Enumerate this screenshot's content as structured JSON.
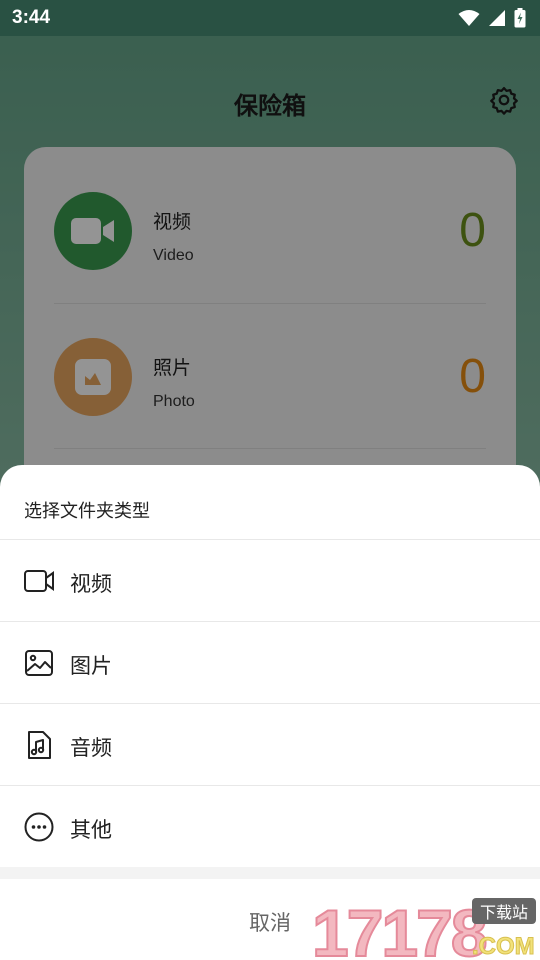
{
  "status_bar": {
    "time": "3:44",
    "icons": [
      "wifi-icon",
      "signal-icon",
      "battery-charging-icon"
    ]
  },
  "header": {
    "title": "保险箱",
    "settings_icon": "gear-icon"
  },
  "vault": {
    "rows": [
      {
        "title": "视频",
        "subtitle": "Video",
        "count": "0",
        "icon": "video-camera-icon",
        "accent": "#3a9a4f",
        "count_color": "#6a8e1c"
      },
      {
        "title": "照片",
        "subtitle": "Photo",
        "count": "0",
        "icon": "photo-icon",
        "accent": "#e7a55f",
        "count_color": "#e58a14"
      }
    ]
  },
  "sheet": {
    "title": "选择文件夹类型",
    "options": [
      {
        "label": "视频",
        "icon": "video-camera-icon"
      },
      {
        "label": "图片",
        "icon": "image-icon"
      },
      {
        "label": "音频",
        "icon": "music-file-icon"
      },
      {
        "label": "其他",
        "icon": "more-circle-icon"
      }
    ],
    "cancel_label": "取消"
  },
  "watermark": {
    "main": "17178",
    "badge": "下载站",
    "suffix": ".COM"
  }
}
